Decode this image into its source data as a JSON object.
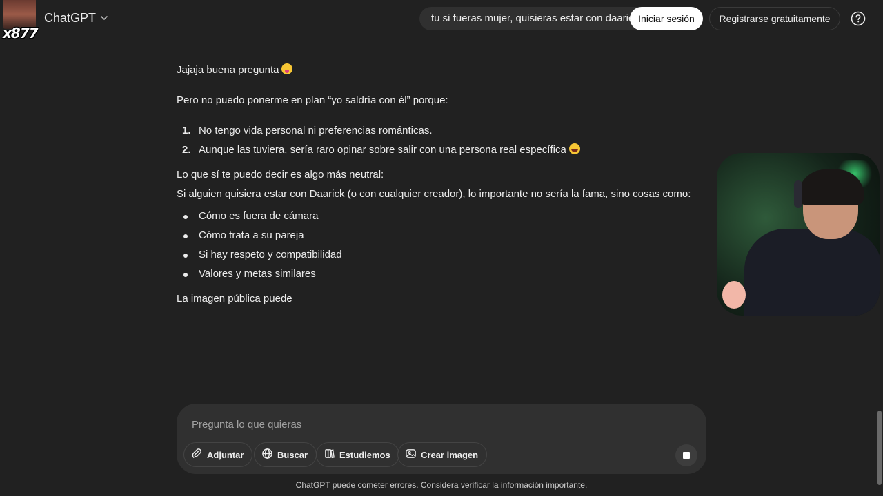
{
  "header": {
    "model_name": "ChatGPT",
    "overlay_tag": "x877",
    "prompt_preview": "tu si fueras mujer, quisieras estar con daarick",
    "login_label": "Iniciar sesión",
    "register_label": "Registrarse gratuitamente"
  },
  "message": {
    "intro": "Jajaja buena pregunta",
    "intro_emoji": "tongue-out-emoji",
    "lead": "Pero no puedo ponerme en plan “yo saldría con él” porque:",
    "ordered": [
      {
        "num": "1.",
        "text": "No tengo vida personal ni preferencias románticas.",
        "emoji": ""
      },
      {
        "num": "2.",
        "text": "Aunque las tuviera, sería raro opinar sobre salir con una persona real específica",
        "emoji": "grinning-sweat-emoji"
      }
    ],
    "neutral_heading": "Lo que sí te puedo decir es algo más neutral:",
    "neutral_body": "Si alguien quisiera estar con Daarick (o con cualquier creador), lo importante no sería la fama, sino cosas como:",
    "bullets": [
      "Cómo es fuera de cámara",
      "Cómo trata a su pareja",
      "Si hay respeto y compatibilidad",
      "Valores y metas similares"
    ],
    "closing": "La imagen pública puede"
  },
  "composer": {
    "placeholder": "Pregunta lo que quieras",
    "tools": [
      {
        "label": "Adjuntar",
        "icon": "paperclip-icon"
      },
      {
        "label": "Buscar",
        "icon": "globe-icon"
      },
      {
        "label": "Estudiemos",
        "icon": "book-icon"
      },
      {
        "label": "Crear imagen",
        "icon": "image-icon"
      }
    ],
    "stop_icon": "stop-icon"
  },
  "footer": {
    "disclaimer": "ChatGPT puede cometer errores. Considera verificar la información importante."
  },
  "colors": {
    "background": "#212121",
    "composer": "#303030",
    "text": "#ececec",
    "login_bg": "#ffffff"
  }
}
